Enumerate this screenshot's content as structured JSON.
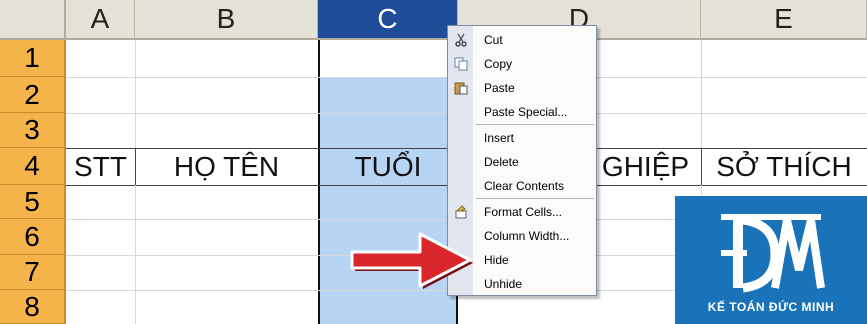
{
  "columns": [
    "A",
    "B",
    "C",
    "D",
    "E"
  ],
  "rows": [
    "1",
    "2",
    "3",
    "4",
    "5",
    "6",
    "7",
    "8"
  ],
  "row4_cells": {
    "a": "STT",
    "b": "HỌ TÊN",
    "c": "TUỔI",
    "d": "GHIỆP",
    "e": "SỞ THÍCH"
  },
  "context_menu": [
    {
      "label": "Cut",
      "icon": "scissors-icon"
    },
    {
      "label": "Copy",
      "icon": "copy-icon"
    },
    {
      "label": "Paste",
      "icon": "paste-icon"
    },
    {
      "label": "Paste Special...",
      "icon": ""
    },
    {
      "label": "Insert",
      "icon": ""
    },
    {
      "label": "Delete",
      "icon": ""
    },
    {
      "label": "Clear Contents",
      "icon": ""
    },
    {
      "label": "Format Cells...",
      "icon": "format-cells-icon"
    },
    {
      "label": "Column Width...",
      "icon": ""
    },
    {
      "label": "Hide",
      "icon": ""
    },
    {
      "label": "Unhide",
      "icon": ""
    }
  ],
  "logo": {
    "mark": "ĐM",
    "caption": "KẾ TOÁN ĐỨC MINH"
  },
  "colors": {
    "selected_header": "#1f4d9a",
    "selected_column": "#b6d4f4",
    "row_header": "#f5b44a",
    "arrow": "#d9262b",
    "logo_bg": "#1a73b8"
  }
}
